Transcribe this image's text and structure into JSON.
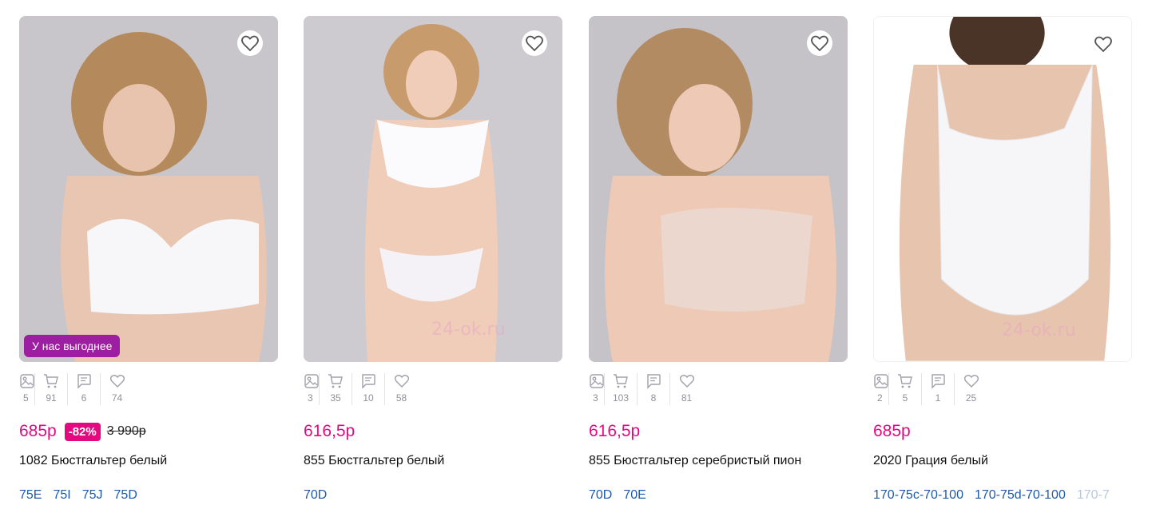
{
  "products": [
    {
      "badge_promo": "У нас выгоднее",
      "stats": {
        "photos": "5",
        "cart": "91",
        "reviews": "6",
        "likes": "74"
      },
      "price": "685р",
      "discount": "-82%",
      "old_price": "3 990р",
      "title": "1082 Бюстгальтер белый",
      "sizes": [
        "75E",
        "75I",
        "75J",
        "75D"
      ]
    },
    {
      "watermark": "24-ok.ru",
      "stats": {
        "photos": "3",
        "cart": "35",
        "reviews": "10",
        "likes": "58"
      },
      "price": "616,5р",
      "title": "855 Бюстгальтер белый",
      "sizes": [
        "70D"
      ]
    },
    {
      "stats": {
        "photos": "3",
        "cart": "103",
        "reviews": "8",
        "likes": "81"
      },
      "price": "616,5р",
      "title": "855 Бюстгальтер серебристый пион",
      "sizes": [
        "70D",
        "70E"
      ]
    },
    {
      "watermark": "24-ok.ru",
      "stats": {
        "photos": "2",
        "cart": "5",
        "reviews": "1",
        "likes": "25"
      },
      "price": "685р",
      "title": "2020 Грация белый",
      "sizes": [
        "170-75c-70-100",
        "170-75d-70-100",
        "170-7"
      ]
    }
  ],
  "colors": {
    "price": "#e5097f",
    "promo": "#9b1fa0",
    "size_link": "#1f5aa8"
  },
  "icons": [
    "heart-icon",
    "image-icon",
    "cart-icon",
    "comment-icon",
    "like-icon"
  ]
}
